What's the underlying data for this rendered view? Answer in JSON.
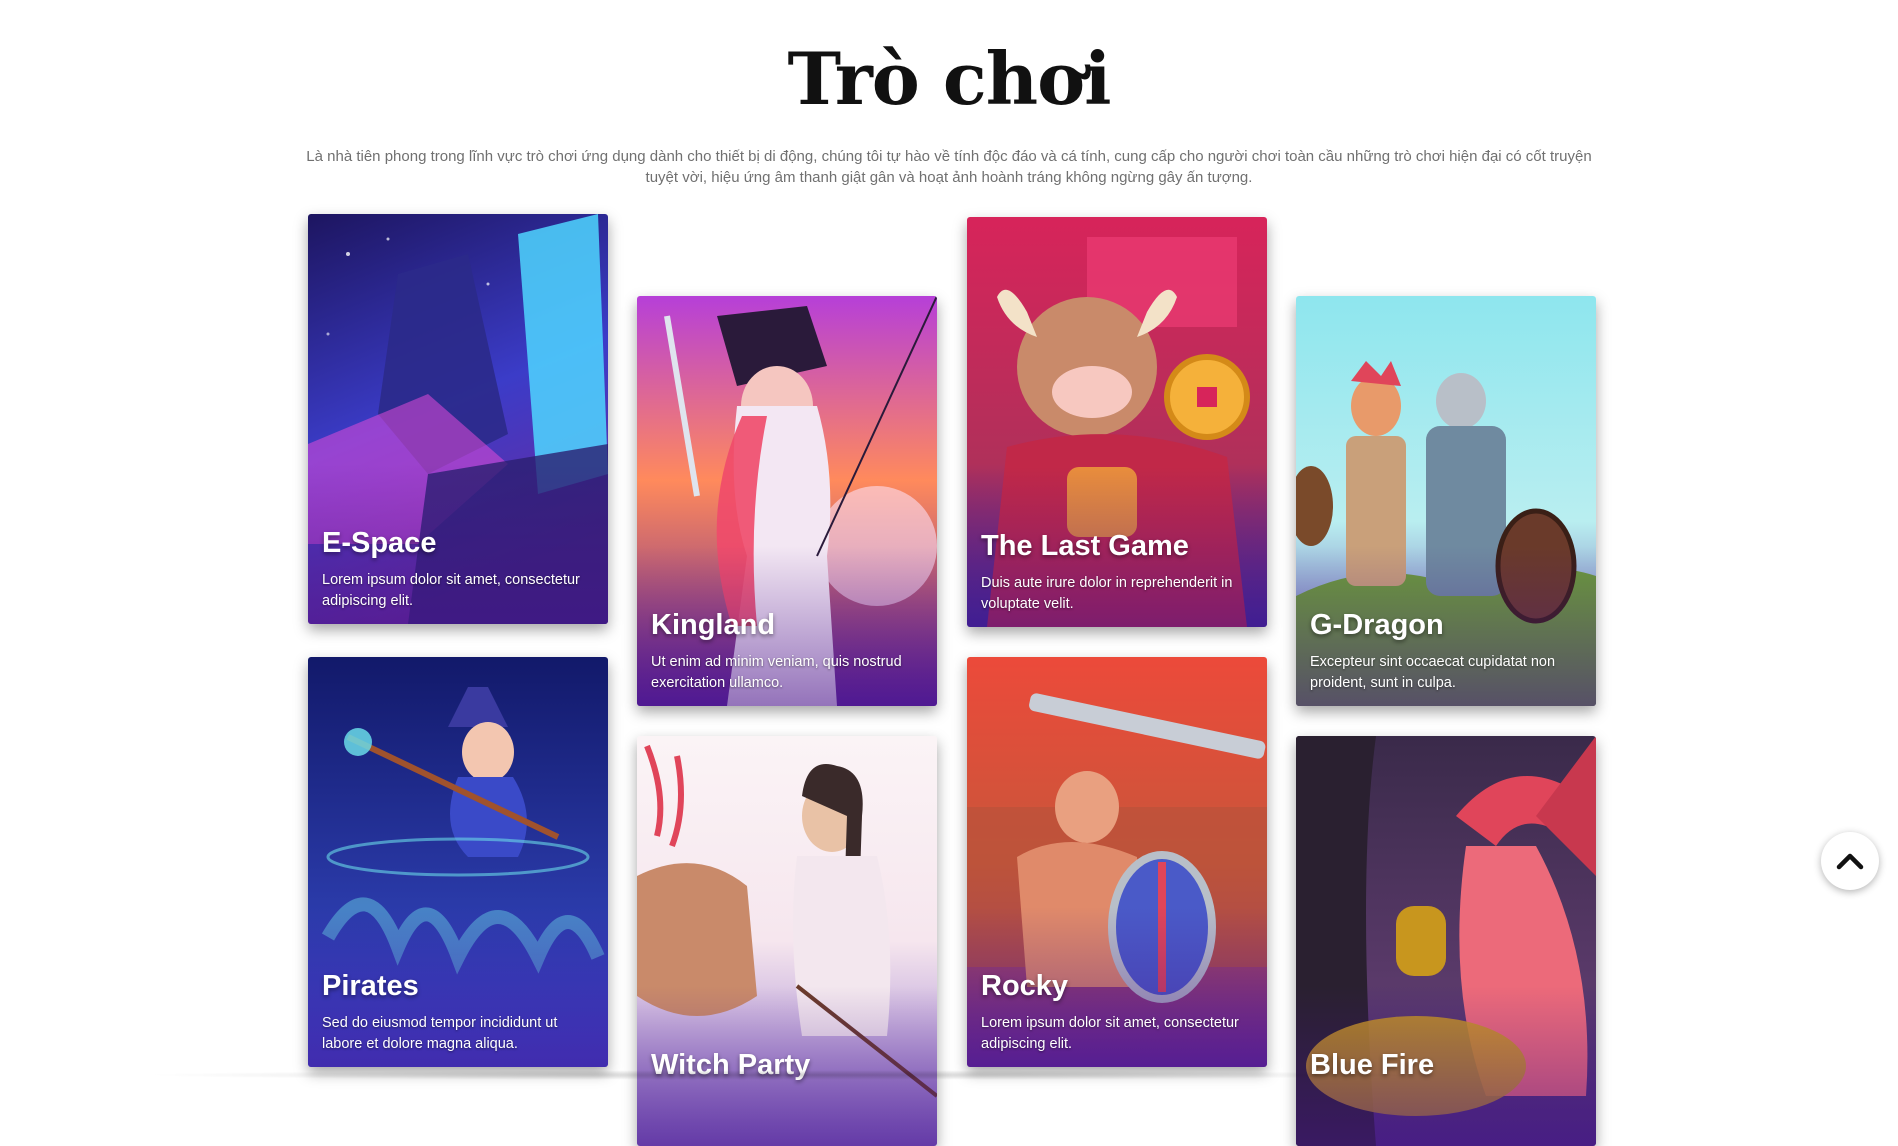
{
  "page": {
    "title": "Trò chơi",
    "intro": "Là nhà tiên phong trong lĩnh vực trò chơi ứng dụng dành cho thiết bị di động, chúng tôi tự hào về tính độc đáo và cá tính, cung cấp cho người chơi toàn cầu những trò chơi hiện đại có cốt truyện tuyệt vời, hiệu ứng âm thanh giật gân và hoạt ảnh hoành tráng không ngừng gây ấn tượng."
  },
  "games": [
    {
      "name": "E-Space",
      "description": "Lorem ipsum dolor sit amet, consectetur adipiscing elit.",
      "palette": [
        "#2a1a7a",
        "#3b3cc8",
        "#e14ad8"
      ]
    },
    {
      "name": "Kingland",
      "description": "Ut enim ad minim veniam, quis nostrud exercitation ullamco.",
      "palette": [
        "#b63fd8",
        "#ff8a5c",
        "#5a1f9a"
      ]
    },
    {
      "name": "The Last Game",
      "description": "Duis aute irure dolor in reprehenderit in voluptate velit.",
      "palette": [
        "#d7245a",
        "#f5b13a",
        "#3a2a9a"
      ]
    },
    {
      "name": "G-Dragon",
      "description": "Excepteur sint occaecat cupidatat non proident, sunt in culpa.",
      "palette": [
        "#8ee6ee",
        "#6b9a3a",
        "#5a3aa0"
      ]
    },
    {
      "name": "Pirates",
      "description": "Sed do eiusmod tempor incididunt ut labore et dolore magna aliqua.",
      "palette": [
        "#12196a",
        "#3a4ad8",
        "#6adbe8"
      ]
    },
    {
      "name": "Witch Party",
      "description": "",
      "palette": [
        "#f6e6ee",
        "#c98a6a",
        "#4a3a9a"
      ]
    },
    {
      "name": "Rocky",
      "description": "Lorem ipsum dolor sit amet, consectetur adipiscing elit.",
      "palette": [
        "#ec4a3a",
        "#f0a03a",
        "#6a2a9a"
      ]
    },
    {
      "name": "Blue Fire",
      "description": "",
      "palette": [
        "#3a2a4a",
        "#e0455a",
        "#c8961e"
      ]
    }
  ],
  "scroll_top": {
    "icon": "chevron-up-icon"
  }
}
